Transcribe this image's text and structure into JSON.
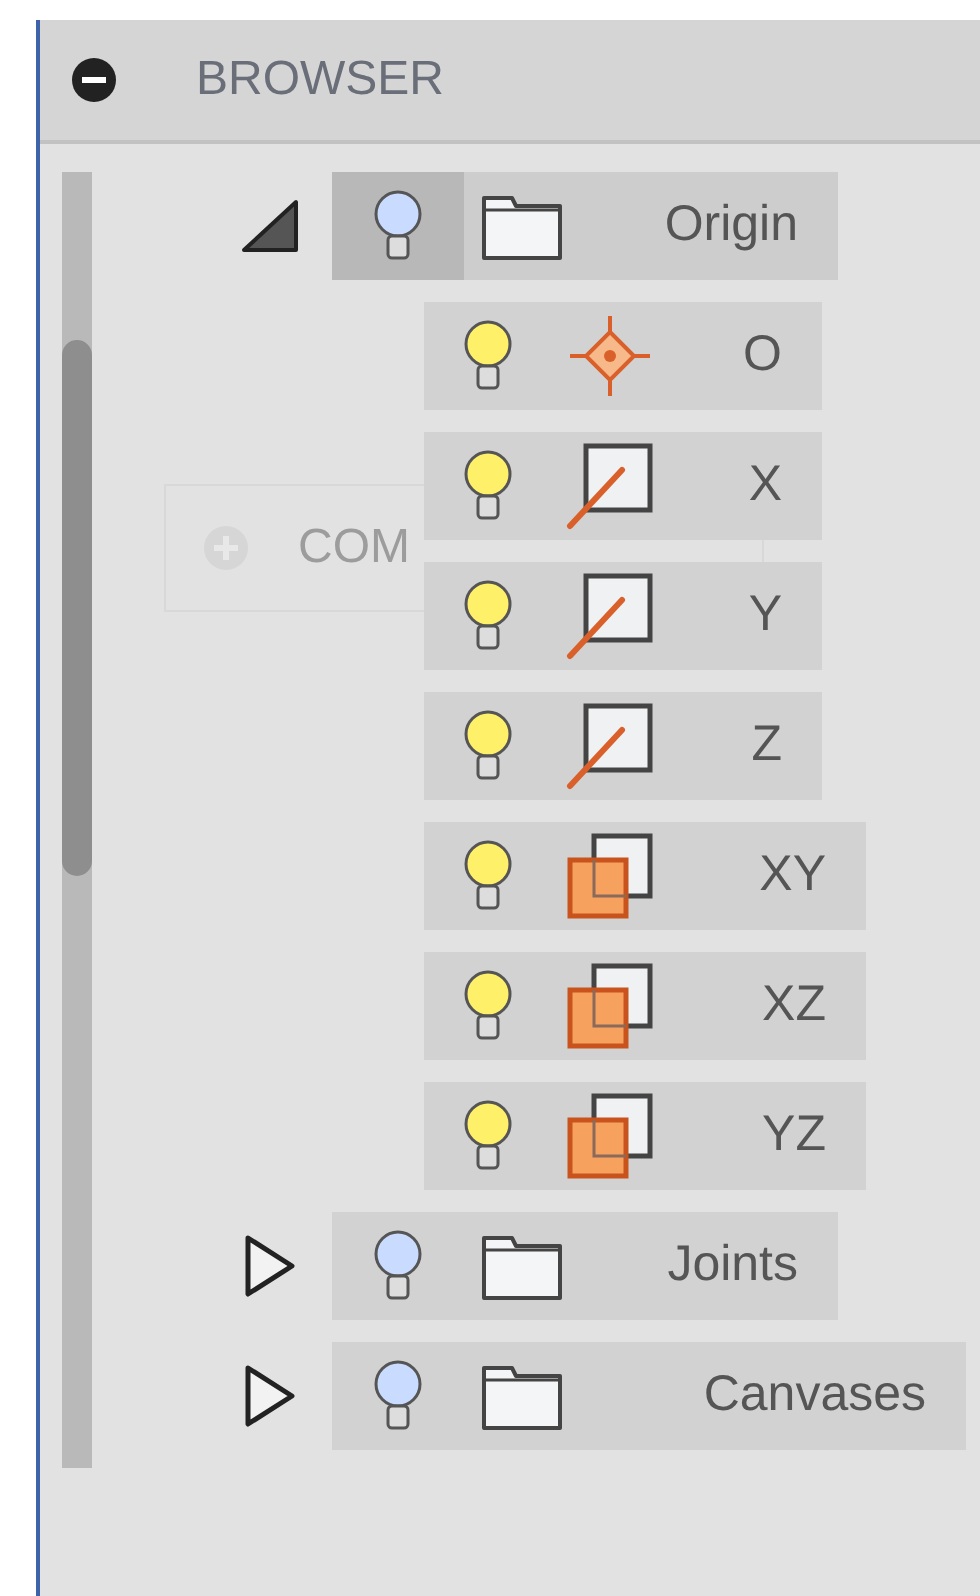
{
  "panel": {
    "title": "BROWSER"
  },
  "background_panel": {
    "title": "COM"
  },
  "tree": [
    {
      "label": "Origin",
      "kind": "folder",
      "expanded": true,
      "selected": true,
      "children": [
        {
          "label": "O",
          "kind": "point",
          "selected": false
        },
        {
          "label": "X",
          "kind": "axis",
          "selected": false
        },
        {
          "label": "Y",
          "kind": "axis",
          "selected": false
        },
        {
          "label": "Z",
          "kind": "axis",
          "selected": false
        },
        {
          "label": "XY",
          "kind": "plane",
          "selected": false
        },
        {
          "label": "XZ",
          "kind": "plane",
          "selected": false
        },
        {
          "label": "YZ",
          "kind": "plane",
          "selected": false
        }
      ]
    },
    {
      "label": "Joints",
      "kind": "folder",
      "expanded": false,
      "selected": false
    },
    {
      "label": "Canvases",
      "kind": "folder",
      "expanded": false,
      "selected": false
    }
  ]
}
